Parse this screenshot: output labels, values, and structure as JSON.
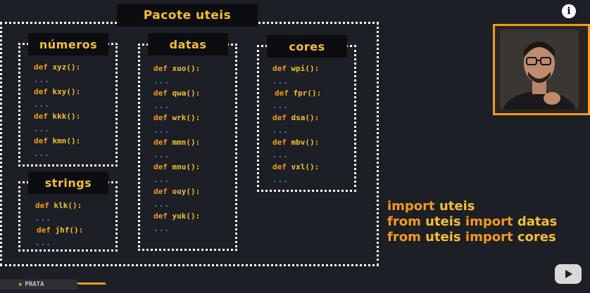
{
  "package_title": "Pacote uteis",
  "modules": {
    "numeros": {
      "title": "números",
      "defs": [
        {
          "kw": "def",
          "fn": "xyz():",
          "dots": "..."
        },
        {
          "kw": "def",
          "fn": "kxy():",
          "dots": "..."
        },
        {
          "kw": "def",
          "fn": "kkk():",
          "dots": "..."
        },
        {
          "kw": "def",
          "fn": "kmn():",
          "dots": "..."
        }
      ]
    },
    "strings": {
      "title": "strings",
      "defs": [
        {
          "kw": "def",
          "fn": "klk():",
          "dots": "..."
        },
        {
          "kw": "def",
          "fn": "jhf():",
          "dots": "..."
        }
      ]
    },
    "datas": {
      "title": "datas",
      "defs": [
        {
          "kw": "def",
          "fn": "xuo():",
          "dots": "..."
        },
        {
          "kw": "def",
          "fn": "qwa():",
          "dots": "..."
        },
        {
          "kw": "def",
          "fn": "wrk():",
          "dots": "..."
        },
        {
          "kw": "def",
          "fn": "mmn():",
          "dots": "..."
        },
        {
          "kw": "def",
          "fn": "mnu():",
          "dots": "..."
        },
        {
          "kw": "def",
          "fn": "ouy():",
          "dots": "..."
        },
        {
          "kw": "def",
          "fn": "yuk():",
          "dots": "..."
        }
      ]
    },
    "cores": {
      "title": "cores",
      "defs": [
        {
          "kw": "def",
          "fn": "wpi():",
          "dots": "..."
        },
        {
          "kw": "def",
          "fn": "fpr():",
          "dots": "..."
        },
        {
          "kw": "def",
          "fn": "dsa():",
          "dots": "..."
        },
        {
          "kw": "def",
          "fn": "mbv():",
          "dots": "..."
        },
        {
          "kw": "def",
          "fn": "vxl():",
          "dots": "..."
        }
      ]
    }
  },
  "imports": [
    {
      "kw": "import",
      "rest1": "uteis",
      "kw2": "",
      "rest2": ""
    },
    {
      "kw": "from",
      "rest1": "uteis",
      "kw2": "import",
      "rest2": "datas"
    },
    {
      "kw": "from",
      "rest1": "uteis",
      "kw2": "import",
      "rest2": "cores"
    }
  ],
  "badge": {
    "label": "PRATA"
  },
  "icons": {
    "info": "i"
  },
  "colors": {
    "background": "#1c1f25",
    "keyword_orange": "#f39a1d",
    "name_yellow": "#f5c02e",
    "dots_blue": "#4f80e8",
    "border_white": "#ffffff"
  }
}
